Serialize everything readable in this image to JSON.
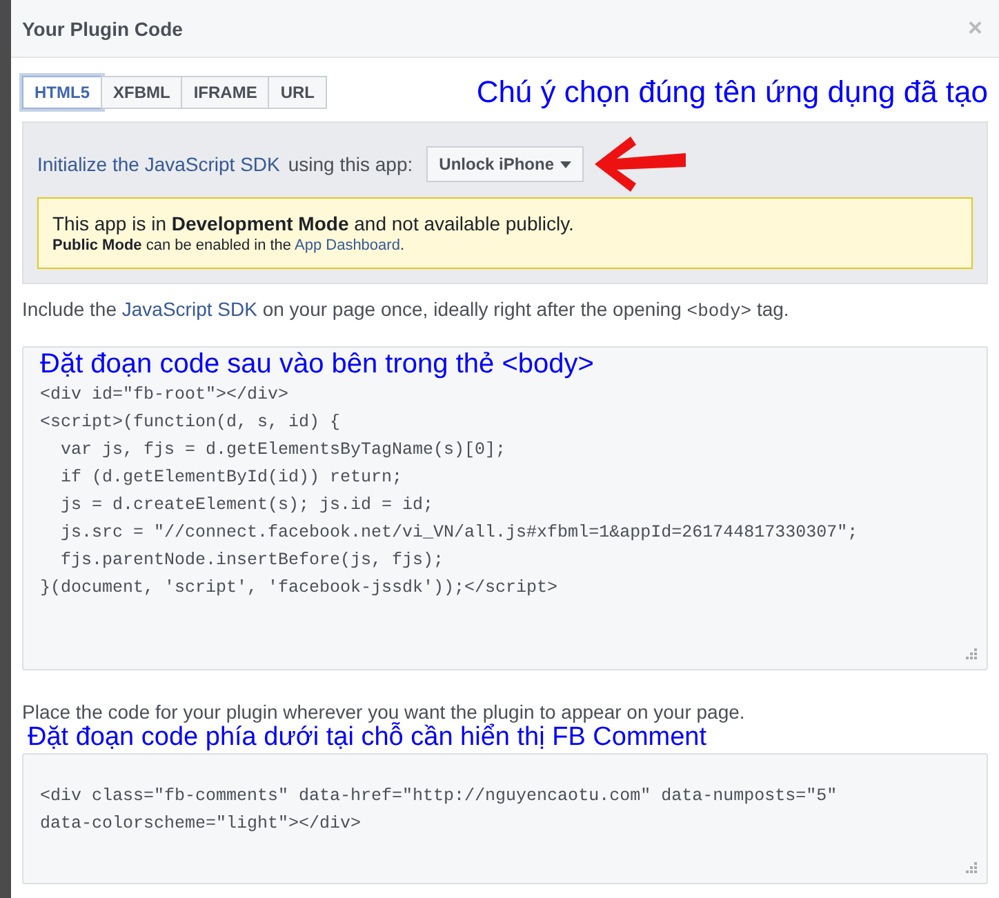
{
  "dialog": {
    "title": "Your Plugin Code",
    "close": "×"
  },
  "tabs": [
    {
      "label": "HTML5",
      "selected": true
    },
    {
      "label": "XFBML",
      "selected": false
    },
    {
      "label": "IFRAME",
      "selected": false
    },
    {
      "label": "URL",
      "selected": false
    }
  ],
  "annotation_top": "Chú ý chọn đúng tên ứng dụng đã tạo",
  "sdk_panel": {
    "link": "Initialize the JavaScript SDK",
    "text": "using this app:",
    "app_dropdown": "Unlock iPhone",
    "notice": {
      "line1": "This app is in **Development Mode** and not available publicly.",
      "line2_bold": "Public Mode",
      "line2_text": "can be enabled in the",
      "line2_link": "App Dashboard",
      "line2_end": "."
    }
  },
  "include_text": {
    "before": "Include the",
    "link": "JavaScript SDK",
    "middle": "on your page once, ideally right after the opening",
    "code": "<body>",
    "after": "tag."
  },
  "annotation_code1": "Đặt đoạn code sau vào bên trong thẻ <body>",
  "code1": [
    "<div id=\"fb-root\"></div>",
    "<script>(function(d, s, id) {",
    "  var js, fjs = d.getElementsByTagName(s)[0];",
    "  if (d.getElementById(id)) return;",
    "  js = d.createElement(s); js.id = id;",
    "  js.src = \"//connect.facebook.net/vi_VN/all.js#xfbml=1&appId=261744817330307\";",
    "  fjs.parentNode.insertBefore(js, fjs);",
    "}(document, 'script', 'facebook-jssdk'));</script>"
  ],
  "place_text": "Place the code for your plugin wherever you want the plugin to appear on your page.",
  "annotation_code2": "Đặt đoạn code phía dưới tại chỗ cần hiển thị FB Comment",
  "code2": [
    "<div class=\"fb-comments\" data-href=\"http://nguyencaotu.com\" data-numposts=\"5\"",
    "data-colorscheme=\"light\"></div>"
  ]
}
